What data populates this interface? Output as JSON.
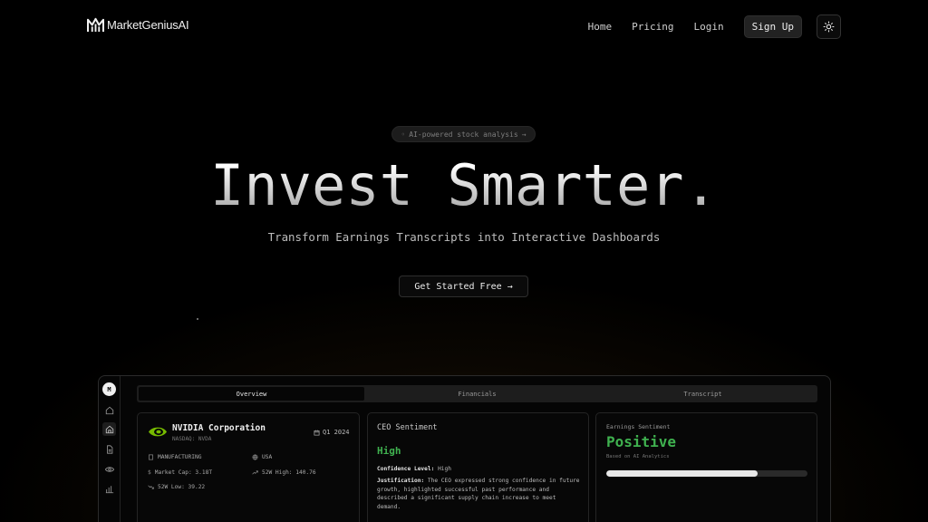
{
  "nav": {
    "logo_text": "MarketGeniusAI",
    "links": [
      "Home",
      "Pricing",
      "Login"
    ],
    "signup": "Sign Up",
    "theme_icon": "sun-icon"
  },
  "hero": {
    "badge": "AI-powered stock analysis",
    "title": "Invest Smarter.",
    "subtitle": "Transform Earnings Transcripts into Interactive Dashboards",
    "cta": "Get Started Free"
  },
  "dashboard": {
    "rail_logo": "M",
    "tabs": [
      "Overview",
      "Financials",
      "Transcript"
    ],
    "active_tab": "Overview",
    "company": {
      "name": "NVIDIA Corporation",
      "ticker": "NASDAQ: NVDA",
      "quarter": "Q1 2024",
      "sector": "MANUFACTURING",
      "country": "USA",
      "market_cap": "Market Cap: 3.18T",
      "high_52w": "52W High: 140.76",
      "low_52w": "52W Low: 39.22"
    },
    "ceo_sentiment": {
      "heading": "CEO Sentiment",
      "value": "High",
      "confidence_label": "Confidence Level:",
      "confidence_value": "High",
      "justification_label": "Justification:",
      "justification": "The CEO expressed strong confidence in future growth, highlighted successful past performance and described a significant supply chain increase to meet demand."
    },
    "earnings_sentiment": {
      "heading": "Earnings Sentiment",
      "value": "Positive",
      "sub": "Based on AI Analytics",
      "progress": 0.75
    }
  },
  "colors": {
    "accent_green": "#3fb14f",
    "nvidia_green": "#76b900"
  }
}
